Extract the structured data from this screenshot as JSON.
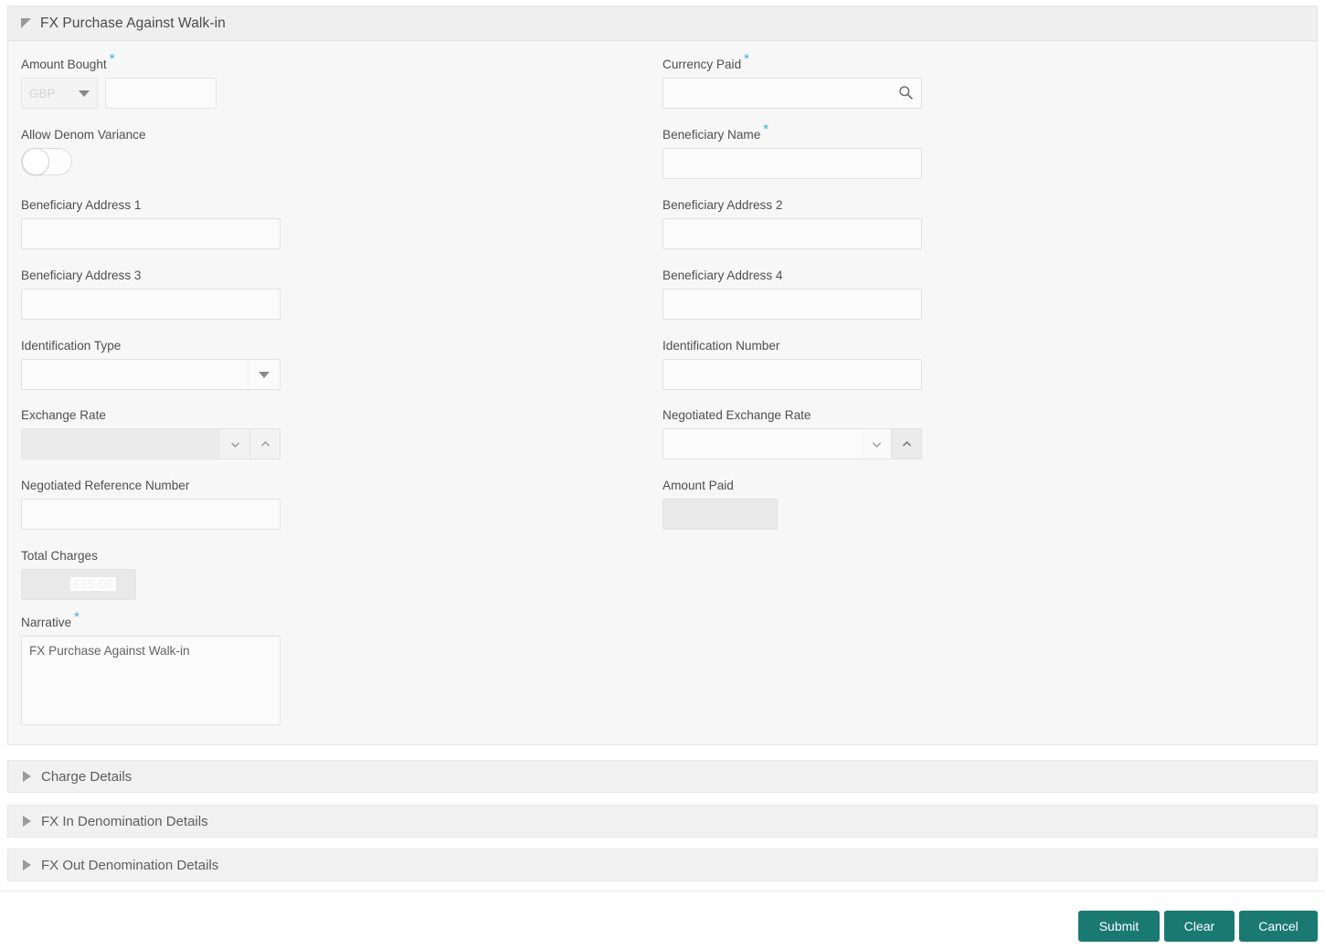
{
  "panel": {
    "title": "FX Purchase Against Walk-in",
    "collapse_icon": "triangle-expanded-icon"
  },
  "fields": {
    "amount_bought": {
      "label": "Amount Bought",
      "required": true,
      "currency": "GBP",
      "amount": "",
      "amount_placeholder": ""
    },
    "currency_paid": {
      "label": "Currency Paid",
      "required": true,
      "value": "",
      "placeholder": "",
      "icon": "search-icon"
    },
    "allow_denom_variance": {
      "label": "Allow Denom Variance",
      "state": "off"
    },
    "beneficiary_name": {
      "label": "Beneficiary Name",
      "required": true,
      "value": "",
      "placeholder": ""
    },
    "beneficiary_address_1": {
      "label": "Beneficiary Address 1",
      "value": "",
      "placeholder": ""
    },
    "beneficiary_address_2": {
      "label": "Beneficiary Address 2",
      "value": "",
      "placeholder": ""
    },
    "beneficiary_address_3": {
      "label": "Beneficiary Address 3",
      "value": "",
      "placeholder": ""
    },
    "beneficiary_address_4": {
      "label": "Beneficiary Address 4",
      "value": "",
      "placeholder": ""
    },
    "identification_type": {
      "label": "Identification Type",
      "value": "",
      "icon": "caret-down-icon"
    },
    "identification_number": {
      "label": "Identification Number",
      "value": "",
      "placeholder": ""
    },
    "exchange_rate": {
      "label": "Exchange Rate",
      "value": "",
      "disabled": true,
      "down_icon": "chevron-down-icon",
      "up_icon": "chevron-up-icon"
    },
    "negotiated_exchange_rate": {
      "label": "Negotiated Exchange Rate",
      "value": "",
      "placeholder": "",
      "down_icon": "chevron-down-icon",
      "up_icon": "chevron-up-icon",
      "up_state": "hovered"
    },
    "negotiated_reference_number": {
      "label": "Negotiated Reference Number",
      "value": "",
      "placeholder": ""
    },
    "amount_paid": {
      "label": "Amount Paid",
      "value": "",
      "disabled": true
    },
    "total_charges": {
      "label": "Total Charges",
      "value": "",
      "masked_value": "££5.00",
      "disabled": true
    },
    "narrative": {
      "label": "Narrative",
      "required": true,
      "value": "FX Purchase Against Walk-in",
      "placeholder": ""
    }
  },
  "sections": [
    {
      "title": "Charge Details",
      "icon": "triangle-right-icon",
      "expanded": false
    },
    {
      "title": "FX In Denomination Details",
      "icon": "triangle-right-icon",
      "expanded": false
    },
    {
      "title": "FX Out Denomination Details",
      "icon": "triangle-right-icon",
      "expanded": false
    }
  ],
  "footer": {
    "submit_label": "Submit",
    "clear_label": "Clear",
    "cancel_label": "Cancel"
  },
  "colors": {
    "button": "#1a7a72",
    "required_asterisk": "#3daddc",
    "panel_bg": "#f7f7f7",
    "header_bg": "#efefef"
  }
}
